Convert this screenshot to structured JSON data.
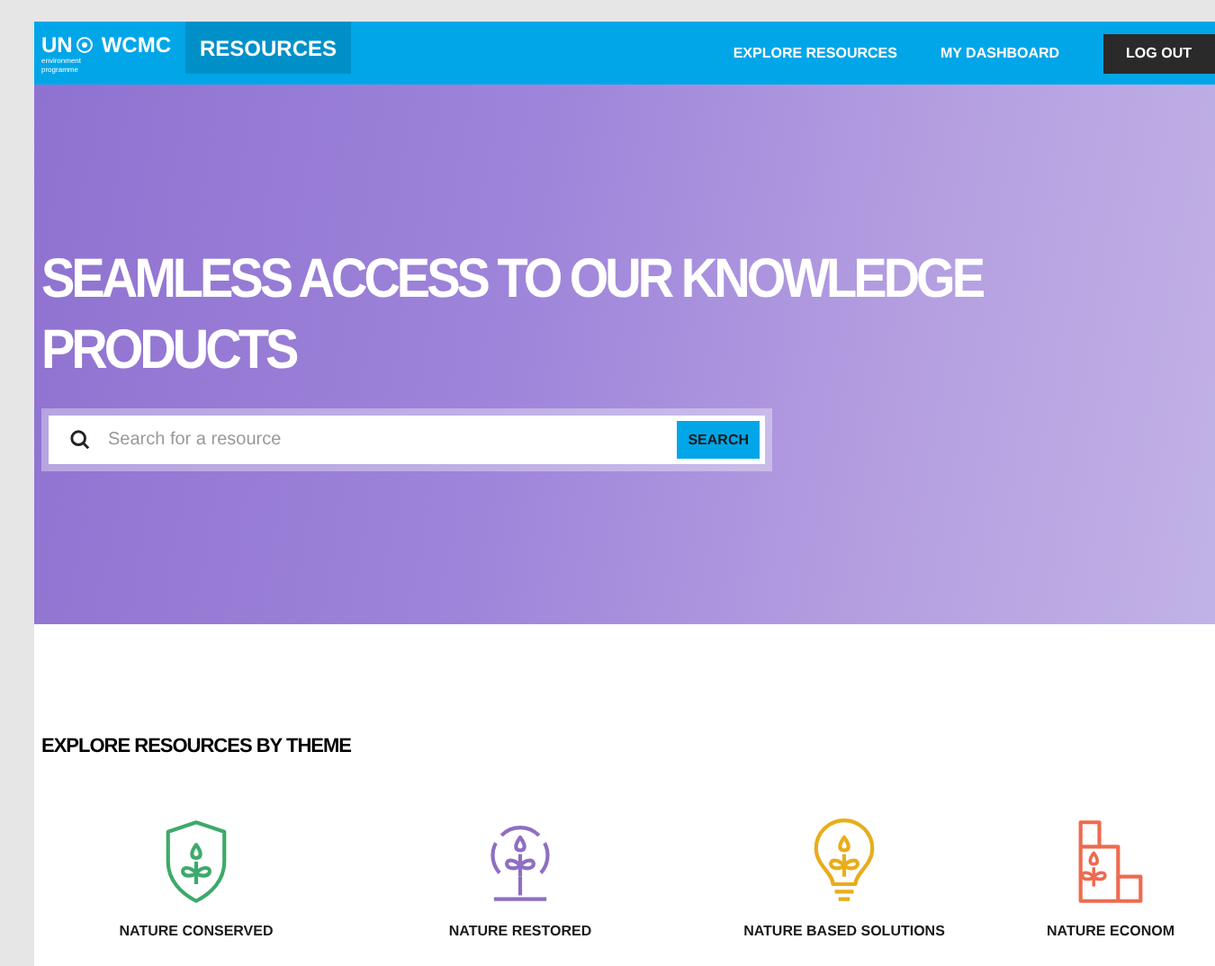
{
  "header": {
    "logo": {
      "un": "UN",
      "wcmc": "WCMC",
      "subtitle": "environment programme"
    },
    "section": "RESOURCES",
    "nav": [
      "EXPLORE RESOURCES",
      "MY DASHBOARD"
    ],
    "logout": "LOG OUT"
  },
  "hero": {
    "title": "SEAMLESS ACCESS TO OUR KNOWLEDGE PRODUCTS",
    "search": {
      "placeholder": "Search for a resource",
      "button": "SEARCH"
    }
  },
  "themes": {
    "heading": "EXPLORE RESOURCES BY THEME",
    "items": [
      {
        "label": "NATURE CONSERVED",
        "color": "#3daa6a"
      },
      {
        "label": "NATURE RESTORED",
        "color": "#8e6fc1"
      },
      {
        "label": "NATURE BASED SOLUTIONS",
        "color": "#e8ad1a"
      },
      {
        "label": "NATURE ECONOM",
        "color": "#ee6a4f"
      }
    ]
  }
}
